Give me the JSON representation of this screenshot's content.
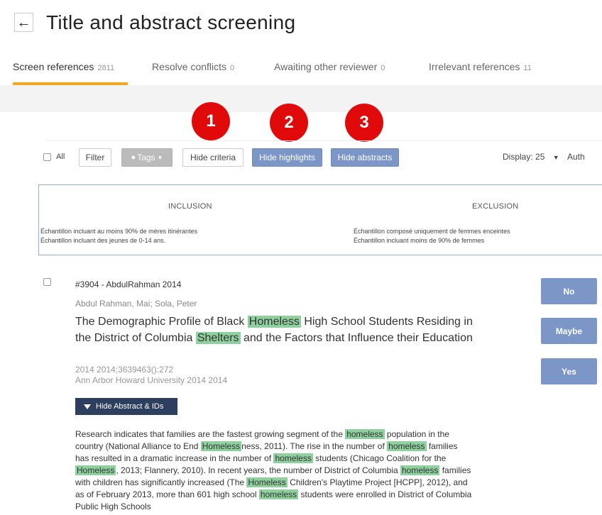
{
  "header": {
    "back_icon": "←",
    "title": "Title and abstract screening"
  },
  "tabs": [
    {
      "label": "Screen references",
      "count": "2811"
    },
    {
      "label": "Resolve conflicts",
      "count": "0"
    },
    {
      "label": "Awaiting other reviewer",
      "count": "0"
    },
    {
      "label": "Irrelevant references",
      "count": "11"
    }
  ],
  "markers": [
    "1",
    "2",
    "3"
  ],
  "toolbar": {
    "all_label": "All",
    "filter_label": "Filter",
    "tags_label": "Tags",
    "hide_criteria_label": "Hide criteria",
    "hide_highlights_label": "Hide highlights",
    "hide_abstracts_label": "Hide abstracts",
    "display_label": "Display: 25",
    "display_caret": "▼",
    "sort_label": "Auth"
  },
  "criteria": {
    "inclusion_heading": "INCLUSION",
    "inclusion_lines": [
      "Échantillon incluant au moins 90% de mères itinérantes",
      "Échantillon incluant des jeunes de 0-14 ans."
    ],
    "exclusion_heading": "EXCLUSION",
    "exclusion_lines": [
      "Échantillon composé uniquement de femmes enceintes",
      "Échantillon incluant moins de 90% de femmes"
    ]
  },
  "reference": {
    "id_line": "#3904 - AbdulRahman 2014",
    "authors": "Abdul Rahman, Mai; Sola, Peter",
    "title_parts": [
      "The Demographic Profile of Black ",
      "Homeless",
      " High School Students Residing in the District of Columbia ",
      "Shelters",
      " and the Factors that Influence their Education"
    ],
    "meta_line1": "2014 2014;3639463():272",
    "meta_line2": "Ann Arbor Howard University 2014 2014",
    "abstract_toggle": "Hide Abstract & IDs",
    "abstract_parts": [
      "Research indicates that families are the fastest growing segment of the ",
      "homeless",
      " population in the country (National Alliance to End ",
      "Homeless",
      "ness, 2011). The rise in the number of ",
      "homeless",
      " families has resulted in a dramatic increase in the number of ",
      "homeless",
      " students (Chicago Coalition for the ",
      "Homeless",
      ", 2013; Flannery, 2010). In recent years, the number of District of Columbia ",
      "homeless",
      " families with children has significantly increased (The ",
      "Homeless",
      " Children's Playtime Project [HCPP], 2012), and as of February 2013, more than 601 high school ",
      "homeless",
      " students were enrolled in District of Columbia Public High Schools"
    ],
    "decisions": {
      "no": "No",
      "maybe": "Maybe",
      "yes": "Yes"
    }
  },
  "colors": {
    "accent": "#f5a623",
    "button_blue": "#7b96c7",
    "highlight": "#8fd19e",
    "marker_red": "#e10a0a"
  }
}
